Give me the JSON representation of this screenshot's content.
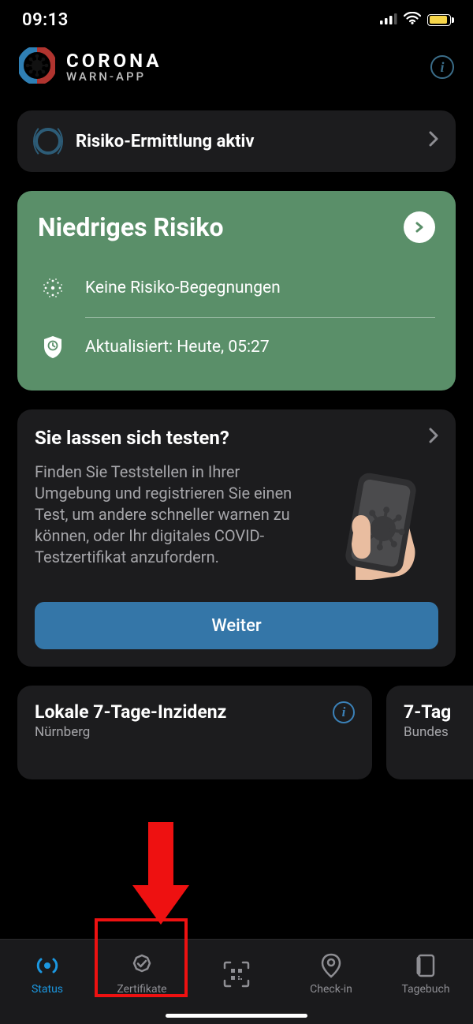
{
  "status_bar": {
    "time": "09:13"
  },
  "header": {
    "logo_line1": "CORONA",
    "logo_line2": "WARN-APP"
  },
  "risk_active": {
    "title": "Risiko-Ermittlung aktiv"
  },
  "risk_card": {
    "title": "Niedriges Risiko",
    "row1": "Keine Risiko-Begegnungen",
    "row2": "Aktualisiert: Heute, 05:27"
  },
  "test_card": {
    "title": "Sie lassen sich testen?",
    "desc": "Finden Sie Teststellen in Ihrer Umgebung und registrieren Sie einen Test, um andere schneller warnen zu können, oder Ihr digitales COVID-Testzertifikat anzufordern.",
    "button": "Weiter"
  },
  "incidence": {
    "card1_title": "Lokale 7-Tage-Inzidenz",
    "card1_sub": "Nürnberg",
    "card2_title": "7-Tag",
    "card2_sub": "Bundes"
  },
  "tabs": {
    "status": "Status",
    "zertifikate": "Zertifikate",
    "checkin": "Check-in",
    "tagebuch": "Tagebuch"
  },
  "colors": {
    "green": "#5a8f69",
    "blue_button": "#3476a8",
    "active_tab": "#1b97e0",
    "card_bg": "#1c1c1e",
    "battery": "#f7d64a",
    "annotation": "#e11"
  }
}
